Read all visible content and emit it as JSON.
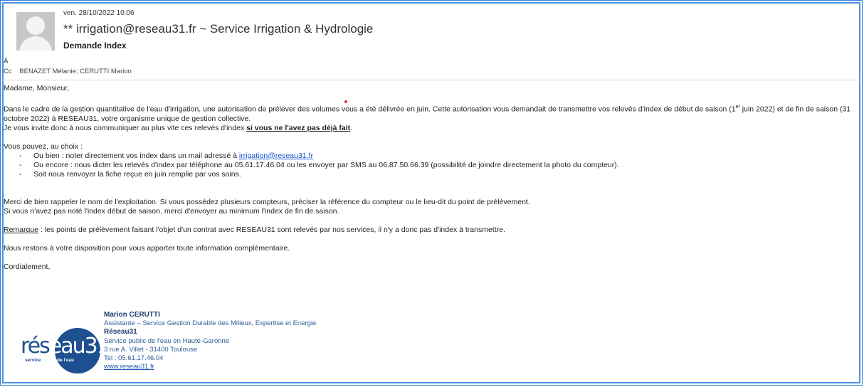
{
  "email": {
    "date": "ven. 28/10/2022 10:06",
    "from": "** irrigation@reseau31.fr ~ Service Irrigation & Hydrologie",
    "subject": "Demande Index",
    "to_label": "À",
    "cc_label": "Cc",
    "cc_value": "BENAZET Mélanie; CERUTTI Marion"
  },
  "body": {
    "greeting": "Madame, Monsieur,",
    "para1_a": "Dans le cadre de la gestion quantitative de l'eau d'irrigation, une autorisation de prélever des volumes vous a été délivrée en juin. Cette autorisation vous demandait de transmettre vos relevés d'index de début de saison (1",
    "para1_sup": "er",
    "para1_b": " juin 2022) et de fin de saison (31 octobre 2022) à RESEAU31, votre organisme unique de gestion collective.",
    "para1_c": "Je vous invite donc à nous communiquer au plus vite ces relevés d'index ",
    "para1_bold": "si vous ne l'avez pas déjà fait",
    "para1_end": ".",
    "choice_intro": "Vous pouvez, au choix :",
    "opt1_a": "Ou bien : noter directement vos index dans un mail adressé à ",
    "opt1_link": "irrigation@reseau31.fr",
    "opt2": "Ou encore : nous dicter les relevés d'index par téléphone au 05.61.17.46.04 ou les envoyer par SMS au 06.87.50.66.39 (possibilité de joindre directement la photo du compteur).",
    "opt3": "Soit nous renvoyer la fiche reçue en juin remplie par vos soins.",
    "para2_a": "Merci de bien rappeler le nom de l'exploitation. Si vous possédez plusieurs compteurs, préciser la référence du compteur ou le lieu-dit du point de prélèvement.",
    "para2_b": "Si vous n'avez pas noté l'index début de saison, merci d'envoyer au minimum l'index de fin de saison.",
    "remark_label": "Remarque",
    "remark_text": " : les points de prélèvement faisant l'objet d'un contrat avec RESEAU31 sont relevés par nos services, il n'y a donc pas d'index à transmettre.",
    "closing1": "Nous restons à votre disposition pour vous apporter toute information complémentaire.",
    "closing2": "Cordialement,"
  },
  "signature": {
    "name": "Marion CERUTTI",
    "role": "Assistante – Service Gestion Durable des Milieux, Expertise et Energie",
    "org": "Réseau31",
    "line1": "Service public de l'eau en Haute-Garonne",
    "address": "3 rue A. Villet - 31400 Toulouse",
    "tel": "Tel : 05.61.17.46.04",
    "website": "www.reseau31.fr"
  },
  "logo": {
    "text_a": "rés",
    "text_b": "eau31",
    "tag_a": "service ",
    "tag_b": "public de l'eau"
  },
  "colors": {
    "accent": "#4a90e2",
    "link": "#1155cc",
    "logo_blue": "#1d4f91"
  }
}
